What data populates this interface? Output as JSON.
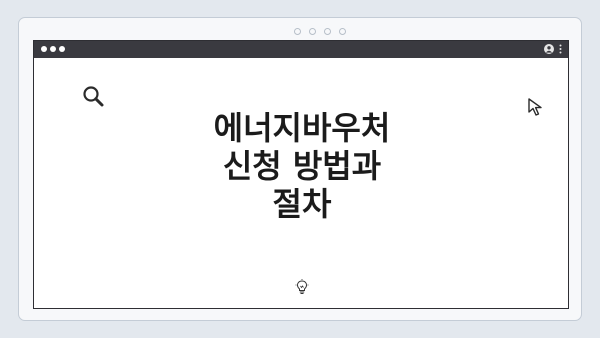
{
  "window": {
    "titlebar_color": "#3a3a40",
    "background": "#ffffff"
  },
  "title": {
    "lines": [
      "에너지바우처",
      "신청 방법과",
      "절차"
    ]
  },
  "icons": {
    "search": "search-icon",
    "cursor": "cursor-icon",
    "bulb": "lightbulb-icon",
    "user": "user-icon",
    "menu": "kebab-menu-icon"
  }
}
